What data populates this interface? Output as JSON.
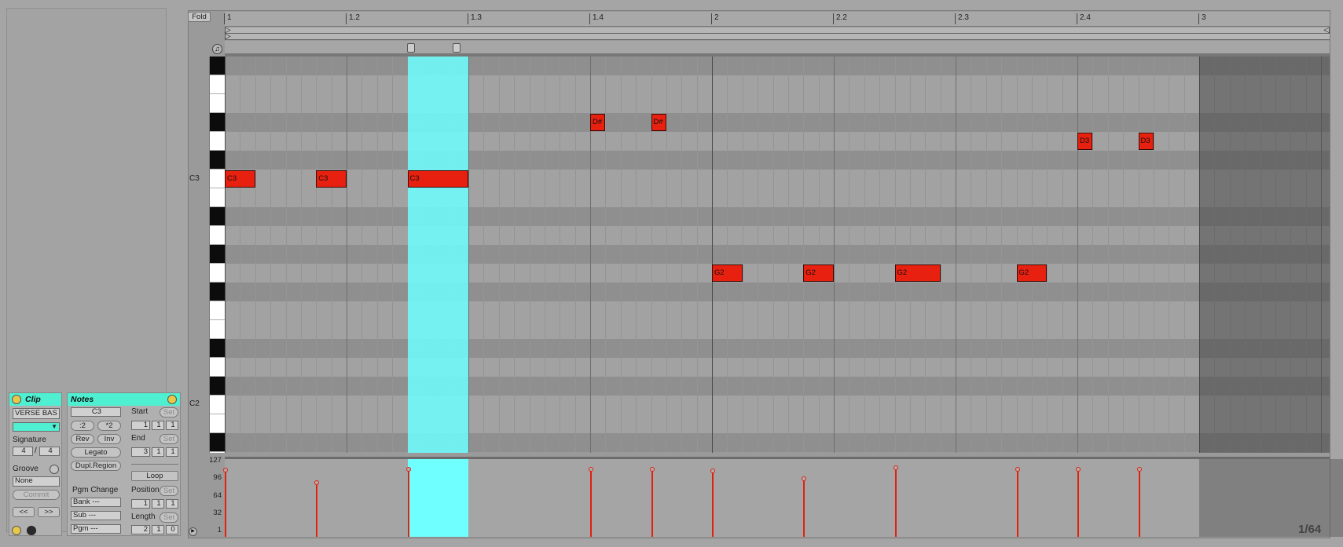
{
  "editor": {
    "fold_label": "Fold",
    "ruler_ticks": [
      "1",
      "1.2",
      "1.3",
      "1.4",
      "2",
      "2.2",
      "2.3",
      "2.4",
      "3"
    ],
    "key_labels": {
      "c3": "C3",
      "c2": "C2"
    },
    "grid_display": "1/64",
    "selection_color": "#6fffff",
    "note_color": "#e8200f",
    "notes": [
      {
        "pitch": "C3",
        "start": 1.0,
        "length": 0.0625
      },
      {
        "pitch": "C3",
        "start": 1.1875,
        "length": 0.0625
      },
      {
        "pitch": "C3",
        "start": 1.375,
        "length": 0.125
      },
      {
        "pitch": "D#",
        "start": 1.75,
        "length": 0.03125
      },
      {
        "pitch": "D#",
        "start": 1.875,
        "length": 0.03125
      },
      {
        "pitch": "G2",
        "start": 2.0,
        "length": 0.0625
      },
      {
        "pitch": "G2",
        "start": 2.1875,
        "length": 0.0625
      },
      {
        "pitch": "G2",
        "start": 2.375,
        "length": 0.09375
      },
      {
        "pitch": "G2",
        "start": 2.625,
        "length": 0.0625
      },
      {
        "pitch": "D3",
        "start": 2.75,
        "length": 0.03125
      },
      {
        "pitch": "D3",
        "start": 2.875,
        "length": 0.03125
      }
    ],
    "velocity_axis": [
      "127",
      "96",
      "64",
      "32",
      "1"
    ],
    "velocities": [
      120,
      98,
      121,
      121,
      121,
      118,
      104,
      124,
      121,
      121,
      121
    ]
  },
  "clip_panel": {
    "header": "Clip",
    "name": "VERSE BAS",
    "signature_label": "Signature",
    "sig_num": "4",
    "sig_slash": "/",
    "sig_den": "4",
    "groove_label": "Groove",
    "groove_value": "None",
    "commit": "Commit",
    "prev": "<<",
    "next": ">>"
  },
  "notes_panel": {
    "header": "Notes",
    "key": "C3",
    "div2": ":2",
    "mul2": "*2",
    "rev": "Rev",
    "inv": "Inv",
    "legato": "Legato",
    "dupl": "Dupl.Region",
    "start_label": "Start",
    "end_label": "End",
    "set": "Set",
    "start": [
      "1",
      "1",
      "1"
    ],
    "end": [
      "3",
      "1",
      "1"
    ],
    "loop": "Loop",
    "pgm_change": "Pgm Change",
    "bank": "Bank ---",
    "sub": "Sub ---",
    "pgm": "Pgm ---",
    "position_label": "Position",
    "position": [
      "1",
      "1",
      "1"
    ],
    "length_label": "Length",
    "length": [
      "2",
      "1",
      "0"
    ]
  }
}
